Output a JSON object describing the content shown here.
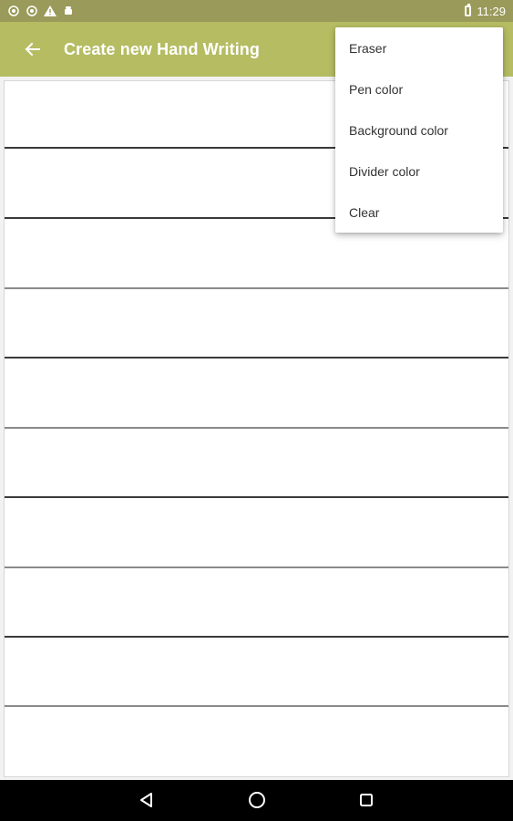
{
  "status_bar": {
    "time": "11:29",
    "icons": [
      "app-notification-icon",
      "app-notification-icon",
      "warning-icon",
      "android-icon",
      "battery-icon"
    ]
  },
  "app_bar": {
    "title": "Create new Hand Writing",
    "back_icon": "arrow-back-icon"
  },
  "menu": {
    "items": [
      {
        "label": "Eraser"
      },
      {
        "label": "Pen color"
      },
      {
        "label": "Background color"
      },
      {
        "label": "Divider color"
      },
      {
        "label": "Clear"
      }
    ]
  },
  "colors": {
    "app_bar": "#b5bc62",
    "status_bar": "#9a9a5a",
    "divider": "#3a3a3a",
    "background": "#ffffff"
  },
  "nav_bar": {
    "icons": [
      "back-triangle-icon",
      "home-circle-icon",
      "recents-square-icon"
    ]
  }
}
